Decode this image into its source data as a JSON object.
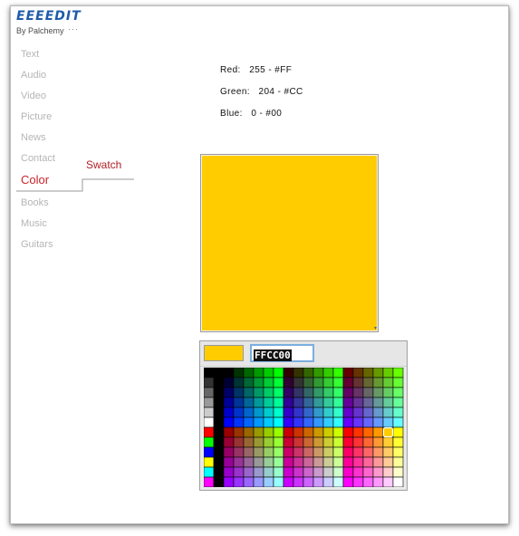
{
  "app": {
    "title": "EEEEDIT",
    "byline": "By Palchemy",
    "byline_dots": "···"
  },
  "nav": {
    "items": [
      "Text",
      "Audio",
      "Video",
      "Picture",
      "News",
      "Contact",
      "Color",
      "Books",
      "Music",
      "Guitars"
    ],
    "active": "Color",
    "sub_item": "Swatch"
  },
  "rgb": {
    "red": "Red:   255 - #FF",
    "green": "Green:   204 - #CC",
    "blue": "Blue:   0 - #00"
  },
  "swatch": {
    "color": "#FFCC00",
    "resize_glyph": "▾"
  },
  "picker": {
    "hex_value": "FFCC00",
    "preview_color": "#FFCC00",
    "selected_color": "#FFCC00"
  },
  "colors": {
    "brand": "#1E5AA8",
    "active_nav": "#C8242B",
    "inactive_nav": "#B5B5B5",
    "selection_border": "#7AAEE0"
  }
}
